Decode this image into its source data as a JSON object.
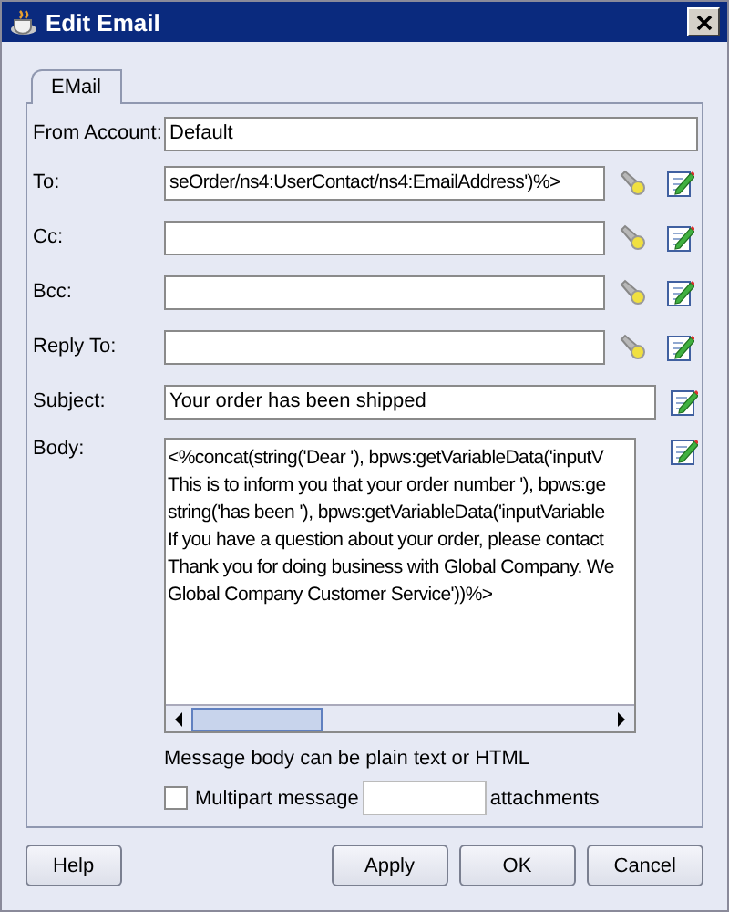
{
  "window": {
    "title": "Edit Email"
  },
  "tabs": [
    {
      "label": "EMail",
      "selected": true
    }
  ],
  "fields": [
    {
      "label": "From Account:",
      "kind": "plain",
      "value": "Default"
    },
    {
      "label": "To:",
      "kind": "lookup",
      "value": "seOrder/ns4:UserContact/ns4:EmailAddress')%>"
    },
    {
      "label": "Cc:",
      "kind": "lookup"
    },
    {
      "label": "Bcc:",
      "kind": "lookup"
    },
    {
      "label": "Reply To:",
      "kind": "lookup"
    },
    {
      "label": "Subject:",
      "kind": "text",
      "value": "Your order has been shipped"
    }
  ],
  "body": {
    "label": "Body:",
    "lines": [
      "<%concat(string('Dear '), bpws:getVariableData('inputV",
      "This is to inform you that your order number '), bpws:ge",
      "string('has been '), bpws:getVariableData('inputVariable",
      "If you have a question about your order, please contact",
      "Thank you for doing business with Global Company. We",
      "Global Company Customer Service'))%>"
    ],
    "hint": "Message body can be plain text or HTML"
  },
  "multipart": {
    "label": "Multipart message",
    "checked": false,
    "suffix": "attachments"
  },
  "buttons": [
    {
      "label": "Help",
      "kind": "left"
    },
    {
      "label": "Apply",
      "kind": "right"
    },
    {
      "label": "OK",
      "kind": "right"
    },
    {
      "label": "Cancel",
      "kind": "right"
    }
  ]
}
